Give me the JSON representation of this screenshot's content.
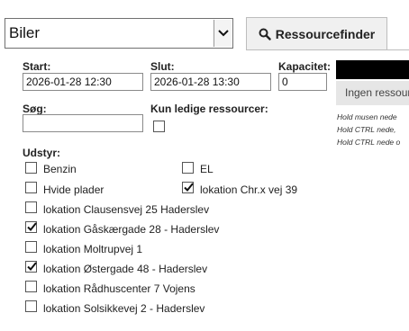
{
  "resource_select": {
    "value": "Biler"
  },
  "tab": {
    "label": "Ressourcefinder",
    "icon": "search-icon"
  },
  "form": {
    "start_label": "Start:",
    "start_value": "2026-01-28 12:30",
    "end_label": "Slut:",
    "end_value": "2026-01-28 13:30",
    "capacity_label": "Kapacitet:",
    "capacity_value": "0",
    "search_label": "Søg:",
    "search_value": "",
    "only_free_label": "Kun ledige ressourcer:",
    "only_free_checked": false,
    "equipment_label": "Udstyr:"
  },
  "equipment": [
    {
      "label": "Benzin",
      "checked": false
    },
    {
      "label": "EL",
      "checked": false
    },
    {
      "label": "Hvide plader",
      "checked": false
    },
    {
      "label": "lokation Chr.x vej 39",
      "checked": true
    },
    {
      "label": "lokation Clausensvej 25 Haderslev",
      "checked": false
    },
    {
      "label": "lokation Gåskærgade 28 - Haderslev",
      "checked": true
    },
    {
      "label": "lokation Moltrupvej 1",
      "checked": false
    },
    {
      "label": "lokation Østergade 48 - Haderslev",
      "checked": true
    },
    {
      "label": "lokation Rådhuscenter 7 Vojens",
      "checked": false
    },
    {
      "label": "lokation Solsikkevej 2 - Haderslev",
      "checked": false
    }
  ],
  "results": {
    "empty_text": "Ingen ressour",
    "hints": [
      "Hold musen nede",
      "Hold CTRL nede,",
      "Hold CTRL nede o"
    ]
  }
}
